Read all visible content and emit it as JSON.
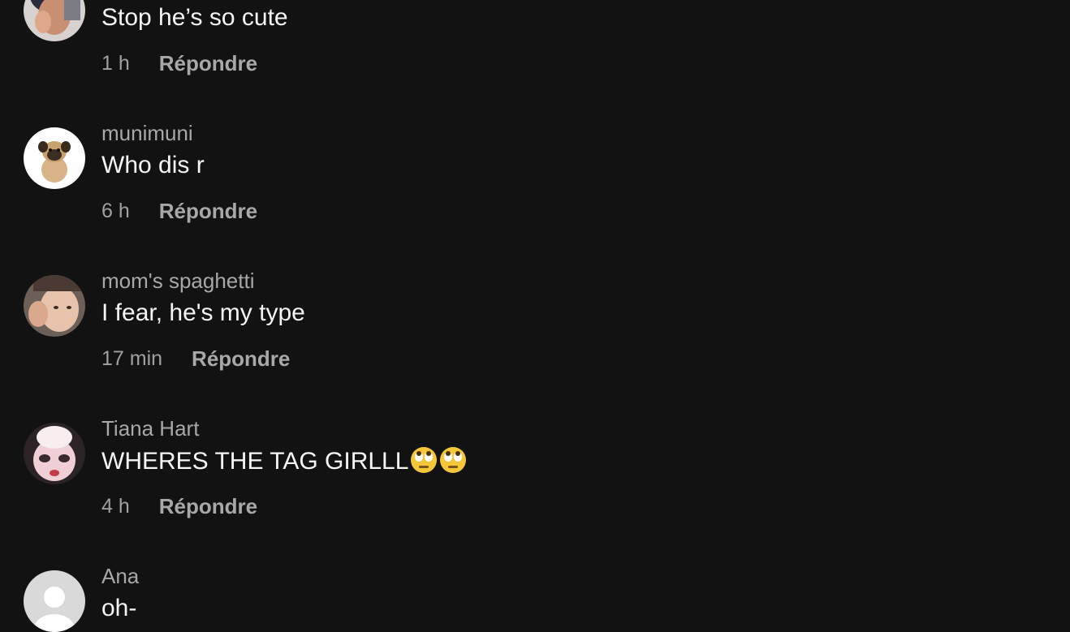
{
  "comments": [
    {
      "username": "",
      "text": "Stop he’s so cute",
      "time": "1 h",
      "reply_label": "Répondre",
      "avatar_icon": "profile-photo"
    },
    {
      "username": "munimuni",
      "text": "Who dis r",
      "time": "6 h",
      "reply_label": "Répondre",
      "avatar_icon": "pug-photo"
    },
    {
      "username": "mom's spaghetti",
      "text": "I fear, he's my type",
      "time": "17 min",
      "reply_label": "Répondre",
      "avatar_icon": "profile-photo"
    },
    {
      "username": "Tiana Hart",
      "text": "WHERES THE TAG GIRLLL",
      "emoji": "🙄🙄",
      "time": "4 h",
      "reply_label": "Répondre",
      "avatar_icon": "doll-photo"
    },
    {
      "username": "Ana",
      "text": "oh-",
      "time": "",
      "reply_label": "",
      "avatar_icon": "default-avatar"
    }
  ],
  "colors": {
    "background": "#121212",
    "primary_text": "#f5f5f5",
    "secondary_text": "#a8a8a8"
  }
}
